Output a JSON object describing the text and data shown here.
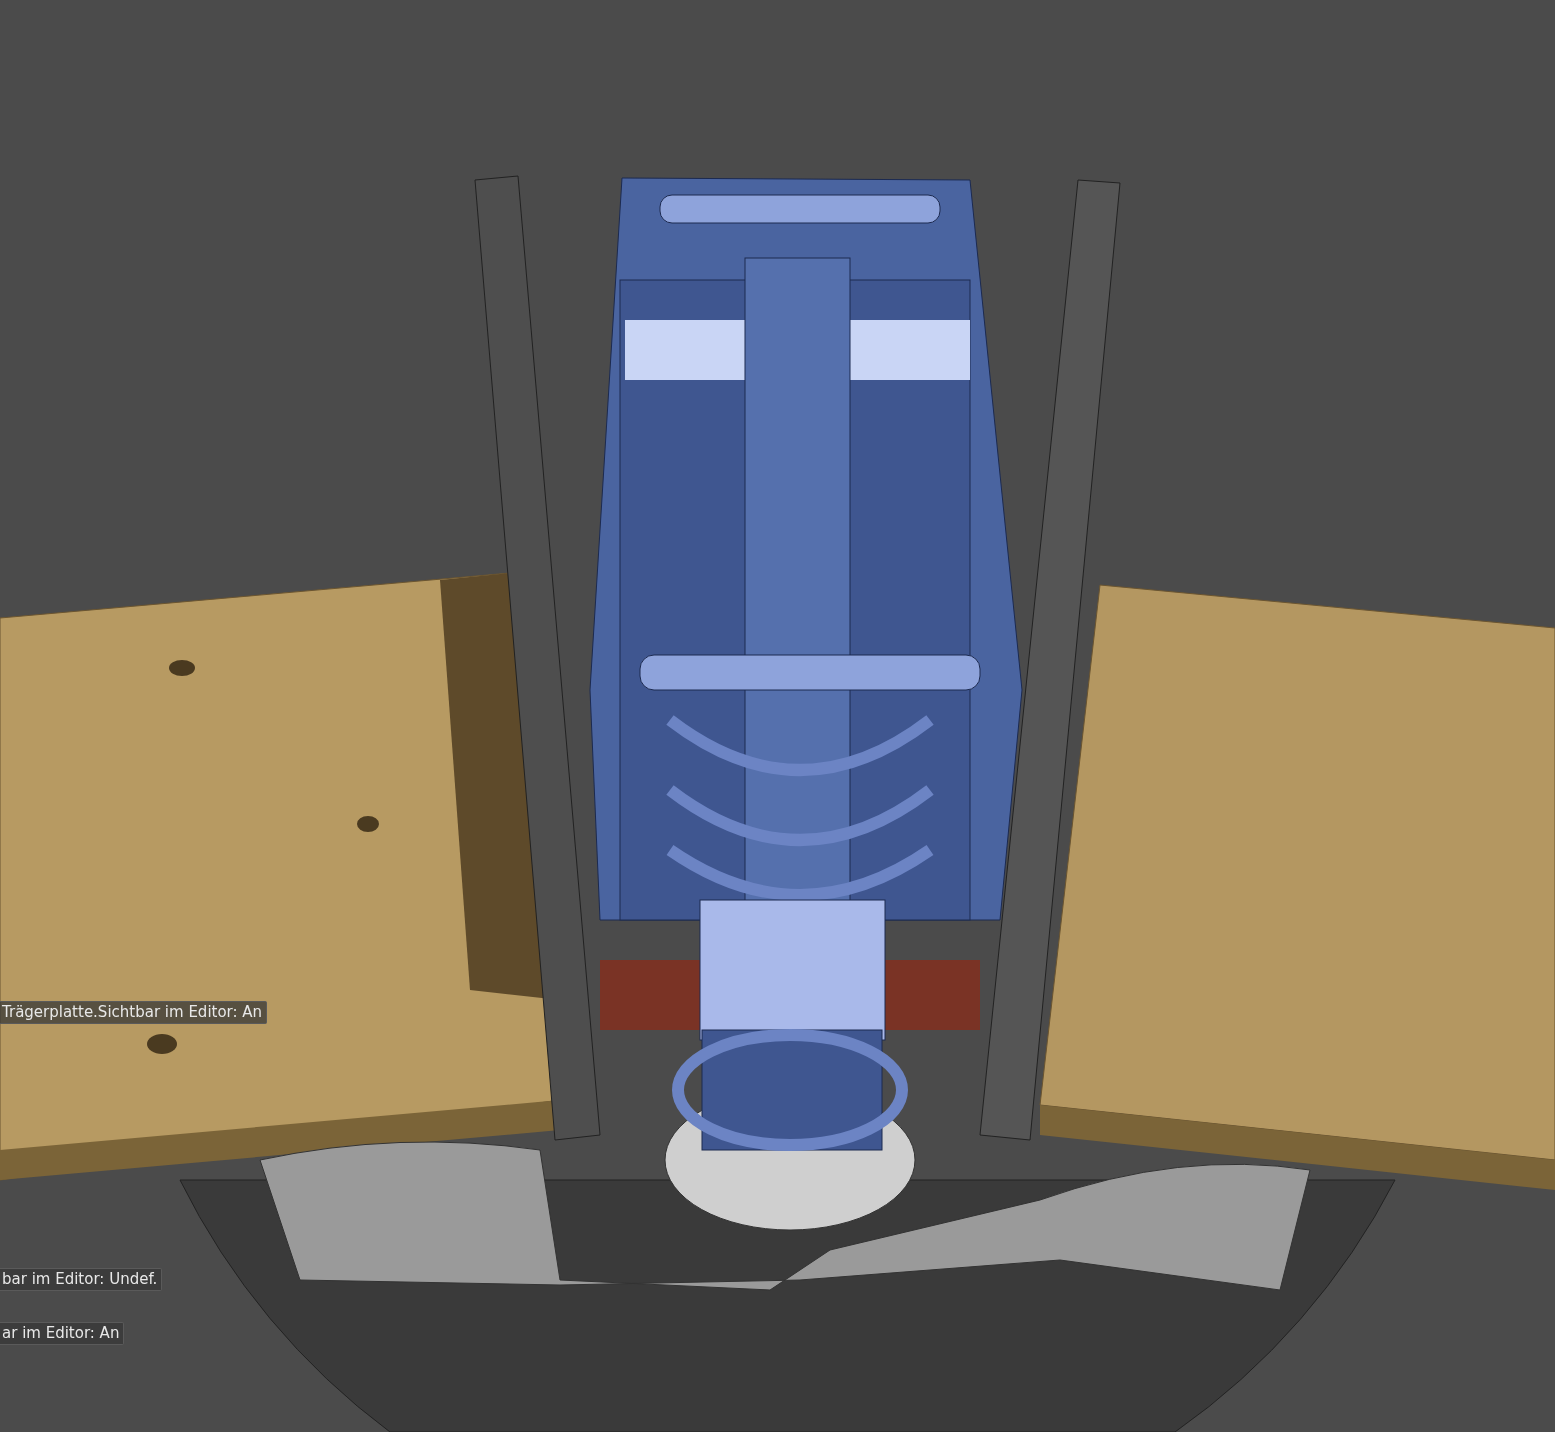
{
  "viewport": {
    "labels": [
      {
        "text": "Trägerplatte.Sichtbar im Editor: An"
      },
      {
        "text": "bar im Editor: Undef."
      },
      {
        "text": "ar im Editor: An"
      }
    ]
  }
}
